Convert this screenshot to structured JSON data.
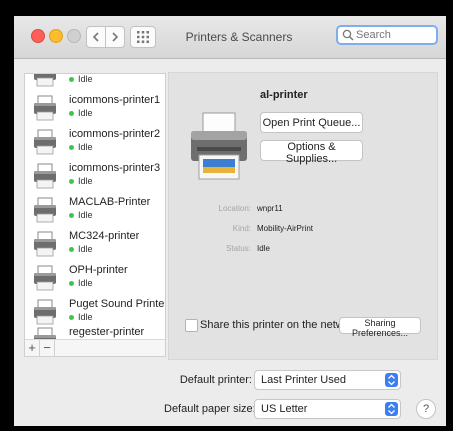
{
  "window": {
    "title": "Printers & Scanners",
    "search_placeholder": "Search"
  },
  "printer_list": [
    {
      "name": "",
      "status": "Idle"
    },
    {
      "name": "icommons-printer1",
      "status": "Idle"
    },
    {
      "name": "icommons-printer2",
      "status": "Idle"
    },
    {
      "name": "icommons-printer3",
      "status": "Idle"
    },
    {
      "name": "MACLAB-Printer",
      "status": "Idle"
    },
    {
      "name": "MC324-printer",
      "status": "Idle"
    },
    {
      "name": "OPH-printer",
      "status": "Idle"
    },
    {
      "name": "Puget Sound Printer",
      "status": "Idle"
    },
    {
      "name": "regester-printer",
      "status": ""
    }
  ],
  "list_controls": {
    "add": "+",
    "remove": "−"
  },
  "detail": {
    "printer_name": "al-printer",
    "open_queue_label": "Open Print Queue...",
    "options_label": "Options & Supplies...",
    "location_label": "Location:",
    "location_value": "wnpr11",
    "kind_label": "Kind:",
    "kind_value": "Mobility-AirPrint",
    "status_label": "Status:",
    "status_value": "Idle",
    "share_label": "Share this printer on the network",
    "sharing_prefs_label": "Sharing Preferences..."
  },
  "defaults": {
    "printer_label": "Default printer:",
    "printer_value": "Last Printer Used",
    "paper_label": "Default paper size:",
    "paper_value": "US Letter",
    "help": "?"
  }
}
